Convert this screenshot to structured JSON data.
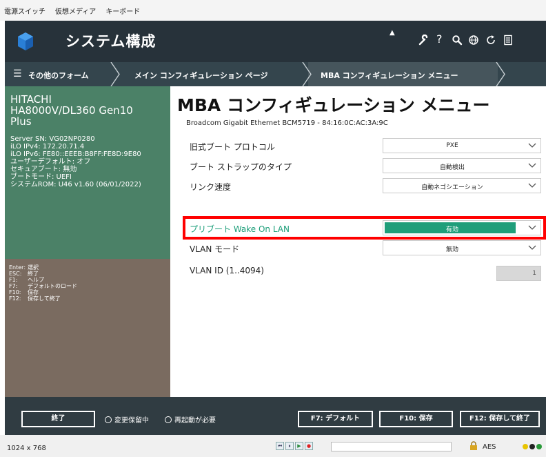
{
  "menubar": {
    "items": [
      "電源スイッチ",
      "仮想メディア",
      "キーボード"
    ]
  },
  "topbar": {
    "title": "システム構成",
    "icons": [
      "wrench-icon",
      "help-icon",
      "search-icon",
      "globe-icon",
      "refresh-icon",
      "document-icon"
    ],
    "help_glyph": "?"
  },
  "breadcrumb": {
    "menu_glyph": "☰",
    "items": [
      "その他のフォーム",
      "メイン コンフィギュレーション ページ",
      "MBA コンフィギュレーション メニュー"
    ]
  },
  "sysinfo": {
    "model": [
      "HITACHI",
      "HA8000V/DL360 Gen10",
      "Plus"
    ],
    "lines": [
      "Server SN: VG02NP0280",
      "iLO IPv4: 172.20.71.4",
      "iLO IPv6: FE80::EEEB:B8FF:FE8D:9E80",
      "ユーザーデフォルト: オフ",
      "セキュアブート: 無効",
      "ブートモード: UEFI",
      "システムROM: U46 v1.60 (06/01/2022)"
    ]
  },
  "keyhelp": [
    {
      "key": "Enter:",
      "desc": "選択"
    },
    {
      "key": "ESC:",
      "desc": "終了"
    },
    {
      "key": "F1:",
      "desc": "ヘルプ"
    },
    {
      "key": "F7:",
      "desc": "デフォルトのロード"
    },
    {
      "key": "F10:",
      "desc": "保存"
    },
    {
      "key": "F12:",
      "desc": "保存して終了"
    }
  ],
  "main": {
    "heading": "MBA コンフィギュレーション メニュー",
    "nic": "Broadcom Gigabit Ethernet BCM5719 - 84:16:0C:AC:3A:9C",
    "settings": [
      {
        "label": "旧式ブート プロトコル",
        "value": "PXE"
      },
      {
        "label": "ブート ストラップのタイプ",
        "value": "自動検出"
      },
      {
        "label": "リンク速度",
        "value": "自動ネゴシエーション"
      },
      {
        "label": "プリブート Wake On LAN",
        "value": "有効"
      },
      {
        "label": "VLAN モード",
        "value": "無効"
      }
    ],
    "vlan_id": {
      "label": "VLAN ID (1..4094)",
      "value": "1"
    }
  },
  "footer": {
    "exit": "終了",
    "radio1": "変更保留中",
    "radio2": "再起動が必要",
    "f7": "F7: デフォルト",
    "f10": "F10: 保存",
    "f12": "F12: 保存して終了"
  },
  "statusbar": {
    "resolution": "1024 x 768",
    "encryption": "AES",
    "media_glyphs": [
      "⏮",
      "⏸",
      "▶",
      "●"
    ]
  },
  "colors": {
    "accent": "#1f9e7a",
    "highlight": "#ff0000",
    "sysinfo_bg": "#4b8167",
    "keyhelp_bg": "#7a6b60"
  }
}
